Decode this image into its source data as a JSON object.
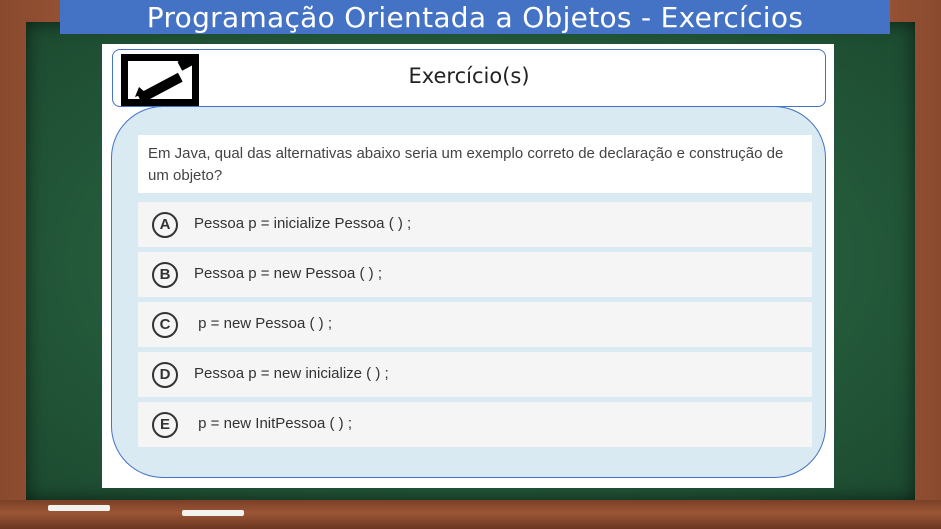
{
  "board": {
    "title": "Programação Orientada a Objetos - Exercícios"
  },
  "header": {
    "icon": "pencil-edit-icon",
    "title": "Exercício(s)"
  },
  "question": {
    "text": "Em Java, qual das alternativas abaixo seria um exemplo correto de declaração e construção de um objeto?"
  },
  "options": [
    {
      "letter": "A",
      "text": "Pessoa p = inicialize Pessoa ( ) ;"
    },
    {
      "letter": "B",
      "text": "Pessoa p = new Pessoa ( ) ;"
    },
    {
      "letter": "C",
      "text": " p = new Pessoa ( ) ;"
    },
    {
      "letter": "D",
      "text": "Pessoa p = new inicialize ( ) ;"
    },
    {
      "letter": "E",
      "text": " p = new InitPessoa ( ) ;"
    }
  ],
  "colors": {
    "title_bar": "#4472c4",
    "panel": "#d9eaf2",
    "board": "#2f6b47",
    "frame": "#a85e3c"
  }
}
